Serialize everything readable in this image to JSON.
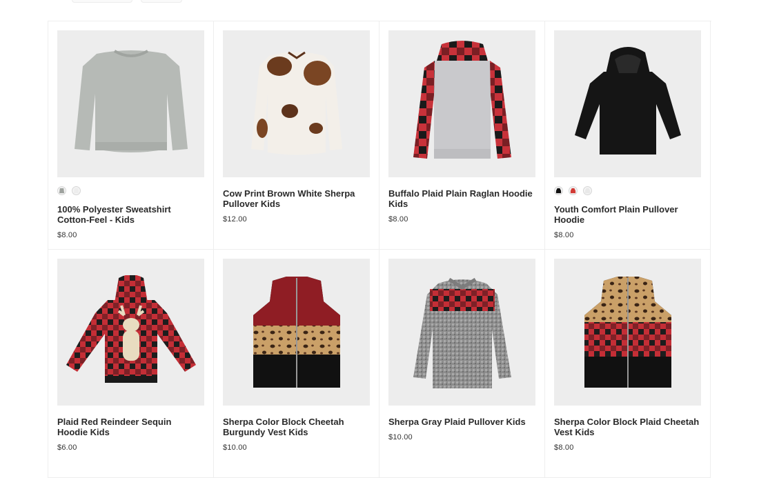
{
  "products": [
    {
      "title": "100% Polyester Sweatshirt Cotton-Feel - Kids",
      "price": "$8.00"
    },
    {
      "title": "Cow Print Brown White Sherpa Pullover Kids",
      "price": "$12.00"
    },
    {
      "title": "Buffalo Plaid Plain Raglan Hoodie Kids",
      "price": "$8.00"
    },
    {
      "title": "Youth Comfort Plain Pullover Hoodie",
      "price": "$8.00"
    },
    {
      "title": "Plaid Red Reindeer Sequin Hoodie Kids",
      "price": "$6.00"
    },
    {
      "title": "Sherpa Color Block Cheetah Burgundy Vest Kids",
      "price": "$10.00"
    },
    {
      "title": "Sherpa Gray Plaid Pullover Kids",
      "price": "$10.00"
    },
    {
      "title": "Sherpa Color Block Plaid Cheetah Vest Kids",
      "price": "$8.00"
    }
  ],
  "swatches": {
    "product_1": [
      {
        "color": "#b4b8b4"
      },
      {
        "color": "#f2f2f2"
      }
    ],
    "product_4": [
      {
        "color": "#111111"
      },
      {
        "color": "#d23a35"
      },
      {
        "color": "#e8e8e8"
      }
    ]
  },
  "colors": {
    "image_background": "#ededed",
    "plaid_red": "#c8323a",
    "plaid_black": "#1a1a1a"
  }
}
